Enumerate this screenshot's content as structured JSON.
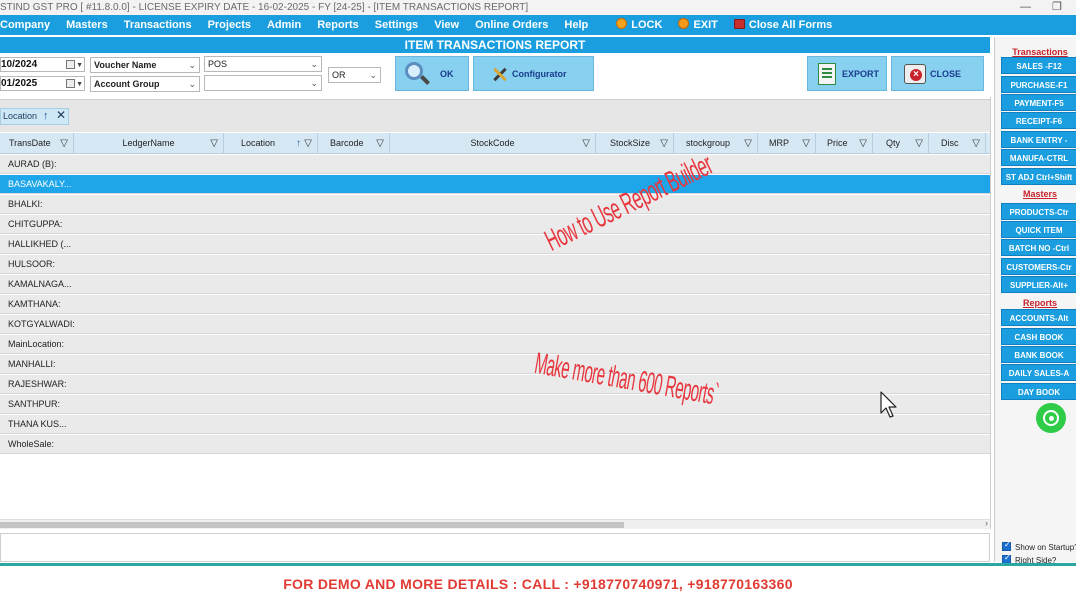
{
  "window": {
    "title": "STIND GST PRO [ #11.8.0.0] - LICENSE EXPIRY DATE - 16-02-2025 - FY [24-25] - [ITEM TRANSACTIONS REPORT]",
    "controls": [
      "—",
      "❐"
    ]
  },
  "menubar": {
    "items": [
      "Company",
      "Masters",
      "Transactions",
      "Projects",
      "Admin",
      "Reports",
      "Settings",
      "View",
      "Online Orders",
      "Help"
    ],
    "lock_label": "LOCK",
    "exit_label": "EXIT",
    "close_all_label": "Close All Forms"
  },
  "report": {
    "title": "ITEM TRANSACTIONS REPORT",
    "from_date": "10/2024",
    "to_date": "01/2025",
    "filter1": "Voucher Name",
    "filter1_value": "POS",
    "filter2": "Account Group",
    "filter2_value": "",
    "logic": "OR",
    "ok_label": "OK",
    "configurator_label": "Configurator",
    "export_label": "EXPORT",
    "close_label": "CLOSE"
  },
  "group": {
    "chip_label": "Location"
  },
  "grid": {
    "columns": [
      "TransDate",
      "LedgerName",
      "Location",
      "Barcode",
      "StockCode",
      "StockSize",
      "stockgroup",
      "MRP",
      "Price",
      "Qty",
      "Disc"
    ],
    "rows": [
      "AURAD (B):",
      "BASAVAKALY...",
      "BHALKI:",
      "CHITGUPPA:",
      "HALLIKHED (...",
      "HULSOOR:",
      "KAMALNAGA...",
      "KAMTHANA:",
      "KOTGYALWADI:",
      "MainLocation:",
      "MANHALLI:",
      "RAJESHWAR:",
      "SANTHPUR:",
      "THANA KUS...",
      "WholeSale:"
    ],
    "selected_row": 1
  },
  "overlay": {
    "line1": "How to Use Report Builder",
    "line2": "Make more than 600 Reports`"
  },
  "right_panel": {
    "sections": [
      {
        "title": "Transactions",
        "buttons": [
          "SALES -F12",
          "PURCHASE-F1",
          "PAYMENT-F5",
          "RECEIPT-F6",
          "BANK ENTRY -",
          "MANUFA-CTRL",
          "ST ADJ Ctrl+Shift"
        ]
      },
      {
        "title": "Masters",
        "buttons": [
          "PRODUCTS-Ctr",
          "QUICK ITEM",
          "BATCH NO -Ctrl",
          "CUSTOMERS-Ctr",
          "SUPPLIER-Alt+"
        ]
      },
      {
        "title": "Reports",
        "buttons": [
          "ACCOUNTS-Alt",
          "CASH BOOK",
          "BANK BOOK",
          "DAILY SALES-A",
          "DAY BOOK"
        ]
      }
    ],
    "show_on_startup": "Show on Startup?",
    "right_side": "Right Side?"
  },
  "footer": {
    "text": "FOR DEMO AND MORE DETAILS : CALL : +918770740971, +918770163360"
  },
  "colors": {
    "menu_blue": "#1a9ee0",
    "selected_row": "#1fa6ea",
    "overlay_red": "#e8363e",
    "footer_red": "#e03a33"
  }
}
